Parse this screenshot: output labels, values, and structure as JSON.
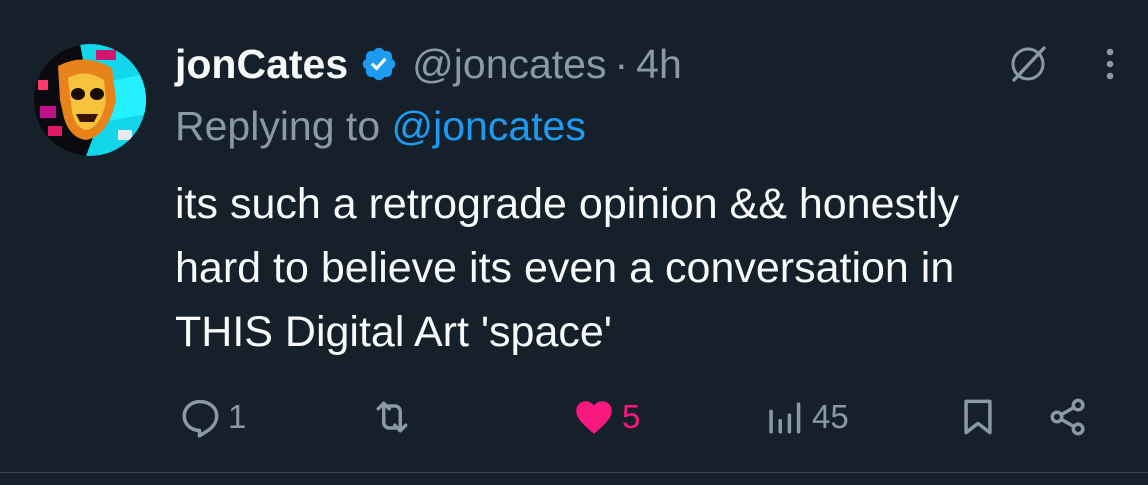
{
  "tweet": {
    "author_name": "jonCates",
    "handle": "@joncates",
    "separator": "·",
    "time": "4h",
    "verified": true,
    "replying_prefix": "Replying to ",
    "replying_to": "@joncates",
    "text": "its such a retrograde opinion && honestly\nhard to believe its even a conversation in\nTHIS Digital Art 'space'"
  },
  "actions": {
    "reply_count": "1",
    "retweet_count": "",
    "like_count": "5",
    "views_count": "45"
  },
  "icons": {
    "verified": "verified-badge-icon",
    "grok": "grok-icon",
    "more": "more-icon",
    "reply": "reply-icon",
    "retweet": "retweet-icon",
    "like": "heart-icon",
    "views": "views-icon",
    "bookmark": "bookmark-icon",
    "share": "share-icon"
  },
  "colors": {
    "background": "#15202b",
    "text": "#f7f9f9",
    "muted": "#8b98a5",
    "accent": "#1d9bf0",
    "like": "#f91880"
  }
}
